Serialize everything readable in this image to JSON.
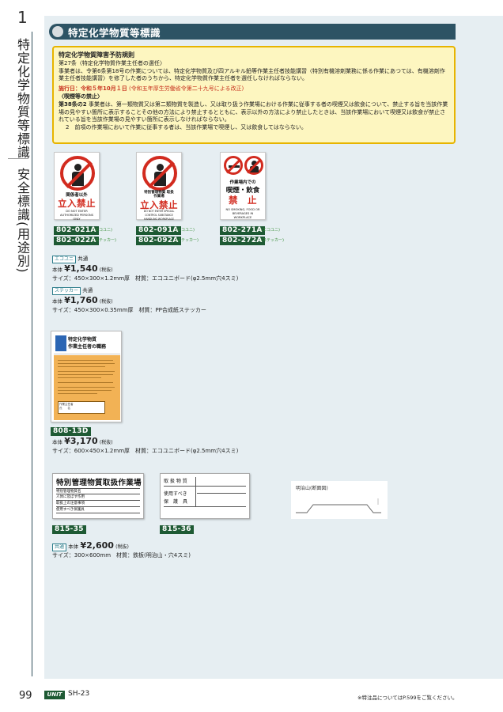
{
  "rail": {
    "chapter_number": "1",
    "category_primary": "特定化学物質等標識",
    "category_secondary": "安全標識(用途別)"
  },
  "section": {
    "title": "特定化学物質等標識"
  },
  "law": {
    "title": "特定化学物質障害予防規則",
    "art27_head": "第27条〈特定化学物質作業主任者の選任〉",
    "art27_body": "事業者は、令第6条第18号の作業については、特定化学物質及び四アルキル鉛等作業主任者技能講習〈特別有機溶剤業務に係る作業にあつては、有機溶剤作業主任者技能講習〉を修了した者のうちから、特定化学物質作業主任者を選任しなければならない。",
    "enforcement_label": "施行日：令和５年10月１日",
    "enforcement_note": "(令和五年厚生労働省令第二十九号による改正)",
    "art38_head": "〈喫煙等の禁止〉",
    "art38_label": "第38条の2",
    "art38_body": "事業者は、第一類物質又は第二類物質を製造し、又は取り扱う作業場における作業に従事する者の喫煙又は飲食について、禁止する旨を当該作業場の見やすい箇所に表示することその他の方法により禁止するとともに、表示以外の方法により禁止したときは、当該作業場において喫煙又は飲食が禁止されている旨を当該作業場の見やすい箇所に表示しなければならない。",
    "art38_item2": "2　前項の作業場において作業に従事する者は、当該作業場で喫煙し、又は飲食してはならない。"
  },
  "signs": [
    {
      "small": "関係者以外",
      "big": "立入禁止",
      "en": "DO NOT ENTER AUTHORIZED PERSONS ONLY",
      "code_a": "802-021A",
      "note_a": "(エコユニ)",
      "code_b": "802-022A",
      "note_b": "(ステッカー)"
    },
    {
      "small": "特別管理物質 取扱作業場",
      "big": "立入禁止",
      "en": "DO NOT ENTER SPECIAL CONTROL SUBSTANCE HANDLING WORKPLACE",
      "code_a": "802-091A",
      "note_a": "(エコユニ)",
      "code_b": "802-092A",
      "note_b": "(ステッカー)"
    },
    {
      "small": "作業場内での",
      "mid": "喫煙・飲食",
      "big": "禁　止",
      "en": "NO SMOKING, FOOD OR BEVERAGES IN WORKPLACE",
      "code_a": "802-271A",
      "note_a": "(エコユニ)",
      "code_b": "802-272A",
      "note_b": "(ステッカー)"
    }
  ],
  "pricing": {
    "eco": {
      "badge": "エコユニ",
      "common": "共通",
      "body_label": "本体",
      "price": "¥1,540",
      "tax": "(税抜)",
      "spec": "サイズ：450×300×1.2mm厚　材質：エコユニボード(φ2.5mm穴4スミ)"
    },
    "sticker": {
      "badge": "ステッカー",
      "common": "共通",
      "body_label": "本体",
      "price": "¥1,760",
      "tax": "(税抜)",
      "spec": "サイズ：450×300×0.35mm厚　材質：PP合成紙ステッカー"
    }
  },
  "role_sign": {
    "title_line1": "特定化学物質",
    "title_line2": "作業主任者の職務",
    "box_label1": "作業主任者",
    "box_label2": "氏　　名",
    "code": "808-13D",
    "body_label": "本体",
    "price": "¥3,170",
    "tax": "(税抜)",
    "spec": "サイズ：600×450×1.2mm厚　材質：エコユニボード(φ2.5mm穴4スミ)"
  },
  "metal_signs": [
    {
      "title": "特別管理物質取扱作業場",
      "rows": [
        "特別管理物質名",
        "人体に及ぼす作用",
        "取扱上の注意事項",
        "使用すべき保護具"
      ],
      "code": "815-35"
    },
    {
      "rows": [
        "取 扱 物 質",
        "使用すべき",
        "保　護　具"
      ],
      "code": "815-36"
    }
  ],
  "metal_pricing": {
    "badge": "共通",
    "body_label": "本体",
    "price": "¥2,600",
    "tax": "(税抜)",
    "spec": "サイズ：300×600mm　材質：鉄板(明治山・穴4スミ)"
  },
  "diagram": {
    "label": "明治山(断面図)"
  },
  "footer": {
    "page_number": "99",
    "logo": "UNIT",
    "page_code": "SH-23",
    "note": "※特注品についてはP.599をご覧ください。"
  },
  "colors": {
    "header_bg": "#2d5364",
    "law_bg": "#fdf6c0",
    "law_border": "#e7b400",
    "code_tag": "#1e5a34",
    "prohibit_red": "#d22b1f",
    "panel_bg": "#e6eef2"
  }
}
